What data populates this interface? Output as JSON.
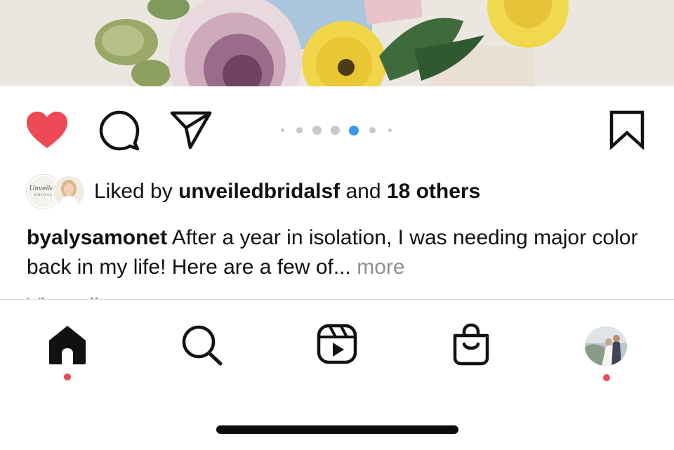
{
  "post": {
    "likes": {
      "prefix": "Liked by",
      "user": "unveiledbridalsf",
      "connector": "and",
      "others": "18 others",
      "avatar_logo_script": "Unveiled",
      "avatar_logo_caps": "BRIDAL"
    },
    "caption": {
      "username": "byalysamonet",
      "text": "After a year in isolation, I was needing major color back in my life! Here are a few of...",
      "more_label": "more"
    },
    "carousel": {
      "count": 7,
      "active_index": 3
    },
    "liked": true,
    "like_color": "#ed4956",
    "active_dot_color": "#3897f0"
  },
  "icons": {
    "like": "heart-icon",
    "comment": "comment-icon",
    "share": "paper-plane-icon",
    "save": "bookmark-icon"
  },
  "tabbar": {
    "tabs": [
      {
        "name": "home",
        "icon": "home-icon",
        "active": true,
        "notification": true
      },
      {
        "name": "search",
        "icon": "search-icon",
        "active": false,
        "notification": false
      },
      {
        "name": "reels",
        "icon": "reels-icon",
        "active": false,
        "notification": false
      },
      {
        "name": "shop",
        "icon": "shopping-bag-icon",
        "active": false,
        "notification": false
      },
      {
        "name": "profile",
        "icon": "profile-avatar",
        "active": false,
        "notification": true
      }
    ],
    "notification_color": "#ed4956"
  }
}
